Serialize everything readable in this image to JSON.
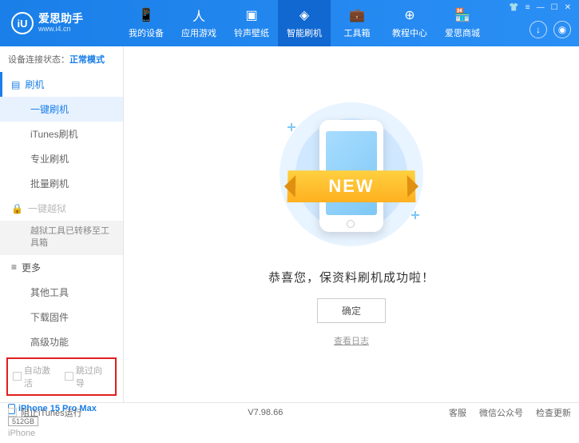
{
  "header": {
    "logo_letter": "iU",
    "logo_title": "爱思助手",
    "logo_sub": "www.i4.cn",
    "tabs": [
      {
        "label": "我的设备"
      },
      {
        "label": "应用游戏"
      },
      {
        "label": "铃声壁纸"
      },
      {
        "label": "智能刷机"
      },
      {
        "label": "工具箱"
      },
      {
        "label": "教程中心"
      },
      {
        "label": "爱思商城"
      }
    ]
  },
  "sidebar": {
    "status_label": "设备连接状态：",
    "status_value": "正常模式",
    "flash_header": "刷机",
    "flash_items": [
      "一键刷机",
      "iTunes刷机",
      "专业刷机",
      "批量刷机"
    ],
    "jailbreak_header": "一键越狱",
    "jailbreak_note": "越狱工具已转移至工具箱",
    "more_header": "更多",
    "more_items": [
      "其他工具",
      "下载固件",
      "高级功能"
    ],
    "checkbox1": "自动激活",
    "checkbox2": "跳过向导",
    "device_name": "iPhone 15 Pro Max",
    "device_storage": "512GB",
    "device_type": "iPhone"
  },
  "main": {
    "new_text": "NEW",
    "success": "恭喜您，保资料刷机成功啦！",
    "ok": "确定",
    "log_link": "查看日志"
  },
  "footer": {
    "block_itunes": "阻止iTunes运行",
    "version": "V7.98.66",
    "links": [
      "客服",
      "微信公众号",
      "检查更新"
    ]
  }
}
